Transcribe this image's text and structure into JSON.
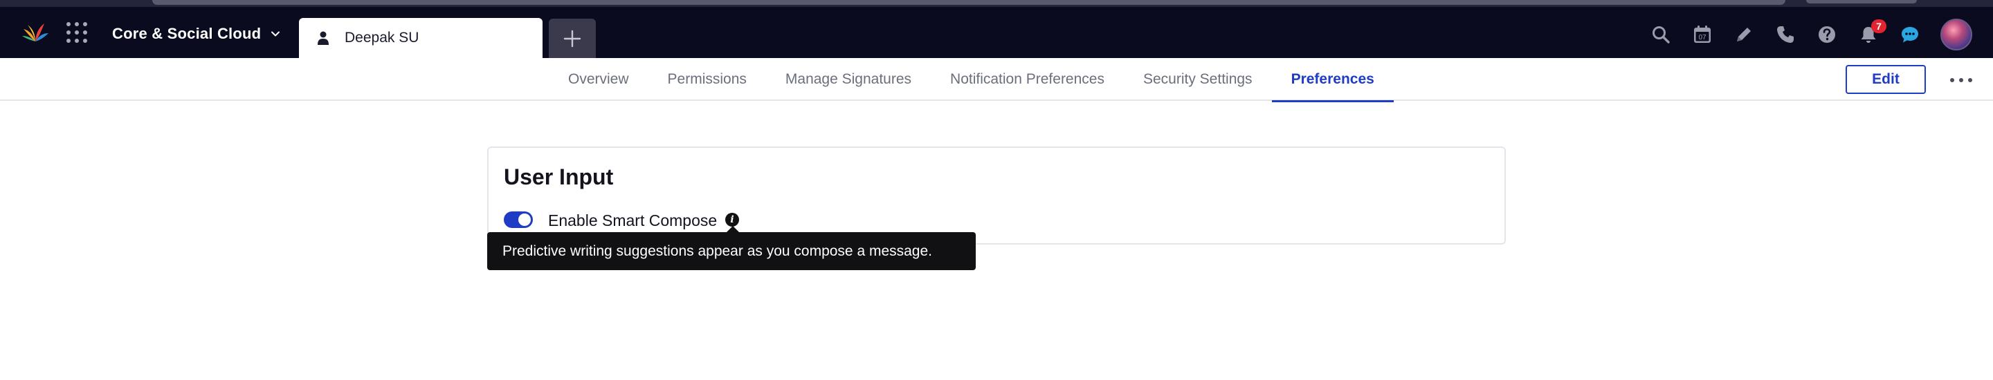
{
  "topbar": {
    "workspace_label": "Core & Social Cloud",
    "active_tab_label": "Deepak SU",
    "notification_count": "7",
    "icons": [
      "search-icon",
      "calendar-icon",
      "pencil-icon",
      "phone-icon",
      "help-icon",
      "bell-icon",
      "chat-icon"
    ]
  },
  "subnav": {
    "tabs": [
      {
        "label": "Overview"
      },
      {
        "label": "Permissions"
      },
      {
        "label": "Manage Signatures"
      },
      {
        "label": "Notification Preferences"
      },
      {
        "label": "Security Settings"
      },
      {
        "label": "Preferences"
      }
    ],
    "active_tab": "Preferences",
    "edit_label": "Edit"
  },
  "card": {
    "title": "User Input",
    "setting_label": "Enable Smart Compose",
    "toggle_on": true
  },
  "tooltip": {
    "text": "Predictive writing suggestions appear as you compose a message."
  },
  "colors": {
    "topbar_bg": "#0b0b1f",
    "accent": "#1f3cc4",
    "badge": "#e2242f",
    "tooltip_bg": "#111114"
  }
}
